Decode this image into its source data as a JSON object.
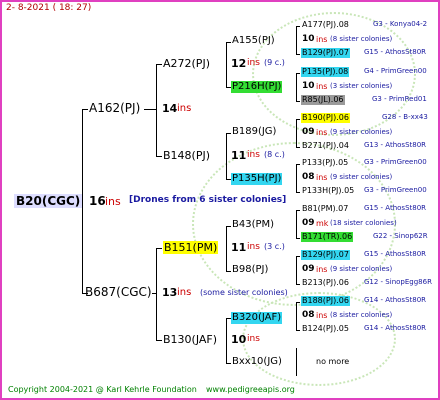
{
  "header": {
    "date": "2-  8-2021 ( 18: 27)"
  },
  "footer": {
    "copyright": "Copyright 2004-2021 @ Karl Kehrle Foundation",
    "site": "www.pedigreeapis.org"
  },
  "tree": {
    "root": {
      "id": "B20(CGC)",
      "ins": "16",
      "ins_label": "ins",
      "note": "[Drones from 6 sister colonies]"
    },
    "sire": {
      "id": "A162(PJ)",
      "ins": "14",
      "ins_label": "ins"
    },
    "dam": {
      "id": "B687(CGC)",
      "ins": "13",
      "ins_label": "ins",
      "note": "(some sister colonies)"
    },
    "ss": {
      "id": "A272(PJ)",
      "ins": "12",
      "ins_label": "ins",
      "note": "(9 c.)"
    },
    "sd": {
      "id": "B148(PJ)",
      "ins": "11",
      "ins_label": "ins",
      "note": "(8 c.)"
    },
    "ds": {
      "id": "B151(PM)",
      "ins": "11",
      "ins_label": "ins",
      "note": "(3 c.)"
    },
    "dd": {
      "id": "B130(JAF)",
      "ins": "10",
      "ins_label": "ins"
    },
    "g3": [
      {
        "id": "A155(PJ)"
      },
      {
        "id": "P216H(PJ)"
      },
      {
        "id": "B189(JG)"
      },
      {
        "id": "P135H(PJ)"
      },
      {
        "id": "B43(PM)"
      },
      {
        "id": "B98(PJ)"
      },
      {
        "id": "B320(JAF)"
      },
      {
        "id": "Bxx10(JG)"
      }
    ],
    "g4": [
      {
        "id": "A177(PJ).08",
        "info": "G3 - Konya04-2"
      },
      {
        "count": "10",
        "ins": "ins",
        "note": "(8 sister colonies)"
      },
      {
        "id": "B129(PJ).07",
        "info": "G15 - AthosSt80R"
      },
      {
        "id": "P135(PJ).08",
        "info": "G4 - PrimGreen00"
      },
      {
        "count": "10",
        "ins": "ins",
        "note": "(3 sister colonies)"
      },
      {
        "id": "R85(JL).06",
        "info": "G3 - PrimRed01"
      },
      {
        "id": "B190(PJ).06",
        "info": "G28 - B-xx43"
      },
      {
        "count": "09",
        "ins": "ins",
        "note": "(9 sister colonies)"
      },
      {
        "id": "B271(PJ).04",
        "info": "G13 - AthosSt80R"
      },
      {
        "id": "P133(PJ).05",
        "info": "G3 - PrimGreen00"
      },
      {
        "count": "08",
        "ins": "ins",
        "note": "(9 sister colonies)"
      },
      {
        "id": "P133H(PJ).05",
        "info": "G3 - PrimGreen00"
      },
      {
        "id": "B81(PM).07",
        "info": "G15 - AthosSt80R"
      },
      {
        "count": "09",
        "ins": "mk",
        "note": "(18 sister colonies)"
      },
      {
        "id": "B171(TR).06",
        "info": "G22 - Sinop62R"
      },
      {
        "id": "B129(PJ).07",
        "info": "G15 - AthosSt80R"
      },
      {
        "count": "09",
        "ins": "ins",
        "note": "(9 sister colonies)"
      },
      {
        "id": "B213(PJ).06",
        "info": "G12 - SinopEgg86R"
      },
      {
        "id": "B188(PJ).06",
        "info": "G14 - AthosSt80R"
      },
      {
        "count": "08",
        "ins": "ins",
        "note": "(8 sister colonies)"
      },
      {
        "id": "B124(PJ).05",
        "info": "G14 - AthosSt80R"
      },
      {
        "no_more": "no more"
      }
    ]
  },
  "colors": {
    "border": "#e040c0",
    "yellow": "#ffff00",
    "cyan": "#33d6f0",
    "green": "#33dd33",
    "gray": "#9a9a9a"
  }
}
